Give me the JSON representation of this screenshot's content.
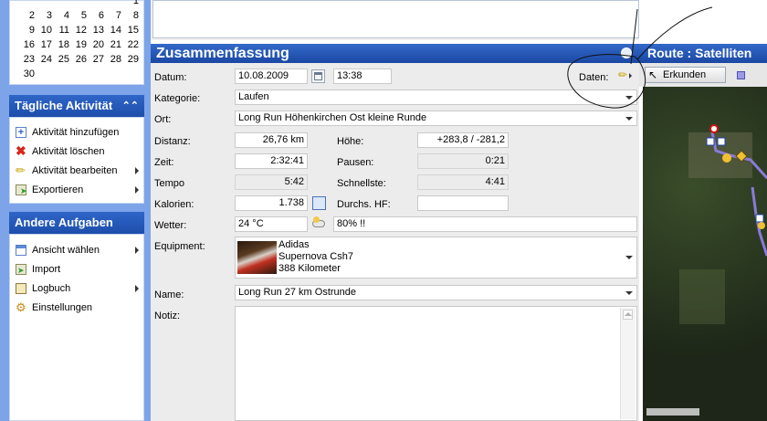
{
  "calendar": {
    "rows": [
      [
        "",
        "",
        "",
        "",
        "",
        "",
        "1"
      ],
      [
        "2",
        "3",
        "4",
        "5",
        "6",
        "7",
        "8"
      ],
      [
        "9",
        "10",
        "11",
        "12",
        "13",
        "14",
        "15"
      ],
      [
        "16",
        "17",
        "18",
        "19",
        "20",
        "21",
        "22"
      ],
      [
        "23",
        "24",
        "25",
        "26",
        "27",
        "28",
        "29"
      ],
      [
        "30",
        "",
        "",
        "",
        "",
        "",
        ""
      ]
    ]
  },
  "daily": {
    "title": "Tägliche Aktivität",
    "items": [
      "Aktivität hinzufügen",
      "Aktivität löschen",
      "Aktivität bearbeiten",
      "Exportieren"
    ]
  },
  "other": {
    "title": "Andere Aufgaben",
    "items": [
      "Ansicht wählen",
      "Import",
      "Logbuch",
      "Einstellungen"
    ]
  },
  "summary": {
    "title": "Zusammenfassung",
    "daten_label": "Daten:",
    "datum_label": "Datum:",
    "datum": "10.08.2009",
    "zeit_uhr": "13:38",
    "kategorie_label": "Kategorie:",
    "kategorie": "Laufen",
    "ort_label": "Ort:",
    "ort": "Long Run Höhenkirchen Ost kleine Runde",
    "distanz_label": "Distanz:",
    "distanz": "26,76 km",
    "hoehe_label": "Höhe:",
    "hoehe": "+283,8 / -281,2",
    "zeit_label": "Zeit:",
    "zeit": "2:32:41",
    "pausen_label": "Pausen:",
    "pausen": "0:21",
    "tempo_label": "Tempo",
    "tempo": "5:42",
    "schnellste_label": "Schnellste:",
    "schnellste": "4:41",
    "kalorien_label": "Kalorien:",
    "kalorien": "1.738",
    "hf_label": "Durchs. HF:",
    "hf": "",
    "wetter_label": "Wetter:",
    "temperatur": "24 °C",
    "wetter_text": "80% !!",
    "equipment_label": "Equipment:",
    "equipment": [
      "Adidas",
      "Supernova Csh7",
      "388 Kilometer"
    ],
    "name_label": "Name:",
    "name": "Long Run 27 km Ostrunde",
    "notiz_label": "Notiz:",
    "notiz": ""
  },
  "map": {
    "title": "Route : Satelliten",
    "explore": "Erkunden"
  },
  "colors": {
    "header_blue": "#1f4fad",
    "sidebar_blue": "#7da4e8",
    "route": "#8a7ad8"
  }
}
